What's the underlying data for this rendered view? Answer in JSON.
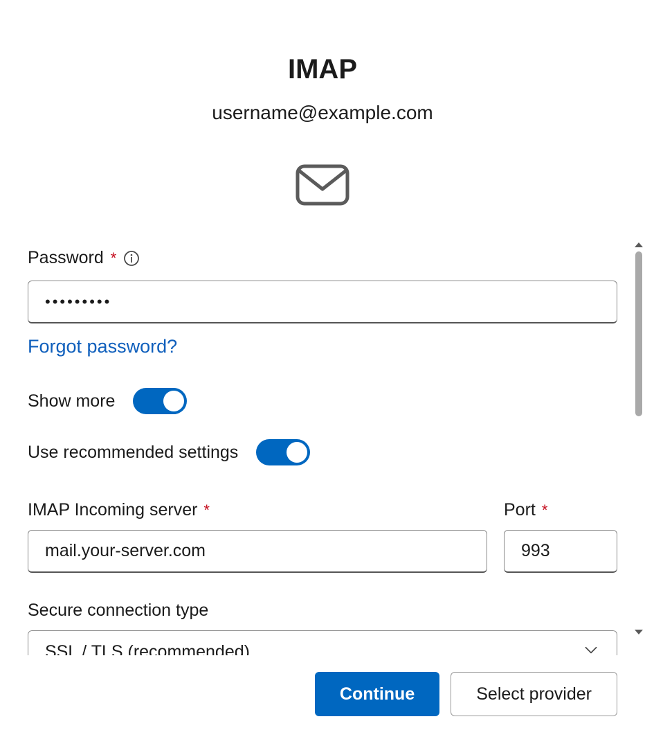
{
  "header": {
    "title": "IMAP",
    "email": "username@example.com"
  },
  "password": {
    "label": "Password",
    "value": "•••••••••",
    "forgot": "Forgot password?"
  },
  "toggles": {
    "show_more": {
      "label": "Show more",
      "on": true
    },
    "recommended": {
      "label": "Use recommended settings",
      "on": true
    }
  },
  "server": {
    "label": "IMAP Incoming server",
    "value": "mail.your-server.com",
    "port_label": "Port",
    "port_value": "993"
  },
  "secure": {
    "label": "Secure connection type",
    "value": "SSL / TLS (recommended)"
  },
  "footer": {
    "continue": "Continue",
    "select_provider": "Select provider"
  }
}
